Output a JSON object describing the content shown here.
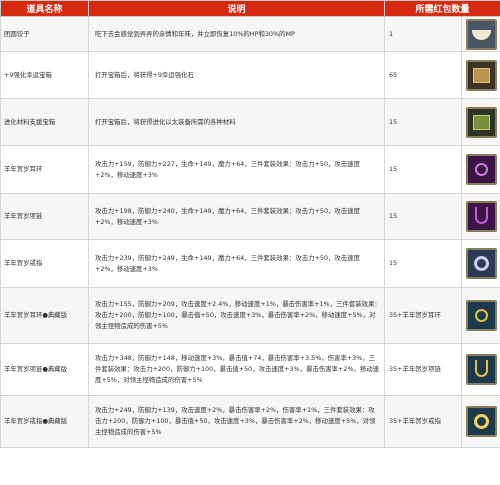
{
  "headers": {
    "name": "道具名称",
    "desc": "说明",
    "qty": "所需红包数量"
  },
  "rows": [
    {
      "name": "团圆饺子",
      "desc": "吃下去会感觉到弄弄的亲情和年味，并立即恢复10%的HP和30%的MP",
      "qty": "1",
      "icon": "dumpling-bowl-icon"
    },
    {
      "name": "+9强化幸运宝箱",
      "desc": "打开宝箱后，将获得+9幸运强化石",
      "qty": "65",
      "icon": "treasure-chest-icon"
    },
    {
      "name": "进化材料支援宝箱",
      "desc": "打开宝箱后，将获得进化以太装备所需的各种材料",
      "qty": "15",
      "icon": "material-chest-icon"
    },
    {
      "name": "羊年贺岁耳环",
      "desc": "攻击力+159，防御力+227，生命+149，魔力+64，三件套装效果：攻击力+50，攻击速度+2%，移动速度+3%",
      "qty": "15",
      "icon": "earring-icon"
    },
    {
      "name": "羊年贺岁项链",
      "desc": "攻击力+198，防御力+240，生命+149，魔力+64，三件套装效果：攻击力+50，攻击速度+2%，移动速度+3%",
      "qty": "15",
      "icon": "necklace-icon"
    },
    {
      "name": "羊年贺岁戒指",
      "desc": "攻击力+239，防御力+249，生命+149，魔力+64，三件套装效果：攻击力+50，攻击速度+2%，移动速度+3%",
      "qty": "15",
      "icon": "ring-icon"
    },
    {
      "name": "羊年贺岁耳环●典藏版",
      "desc": "攻击力+155，防御力+209，攻击速度+2.4%，移动速度+1%，暴击伤害率+1%，三件套装效果：攻击力+200，防御力+100，暴击值+50，攻击速度+3%，暴击伤害率+2%，移动速度+5%，对领主怪物造成的伤害+5%",
      "qty": "35+羊年贺岁耳环",
      "icon": "earring-deluxe-icon"
    },
    {
      "name": "羊年贺岁项链●典藏版",
      "desc": "攻击力+348，防御力+148，移动速度+3%，暴击值+74，暴击伤害率+3.5%，伤害率+3%，三件套装效果：攻击力+200，防御力+100，暴击值+50，攻击速度+3%，暴击伤害率+2%，移动速度+5%，对领主怪物造成的伤害+5%",
      "qty": "35+羊年贺岁项链",
      "icon": "necklace-deluxe-icon"
    },
    {
      "name": "羊年贺岁戒指●典藏版",
      "desc": "攻击力+249，防御力+139，攻击速度+2%，暴击伤害率+2%，伤害率+1%，三件套装效果：攻击力+200，防御力+100，暴击值+50，攻击速度+3%，暴击伤害率+2%，移动速度+5%，对领主怪物造成的伤害+5%",
      "qty": "35+羊年贺岁戒指",
      "icon": "ring-deluxe-icon"
    }
  ],
  "colors": {
    "header_bg": "#d62a10",
    "header_text": "#ffffff",
    "row_alt_bg": "#f6f6f6"
  }
}
